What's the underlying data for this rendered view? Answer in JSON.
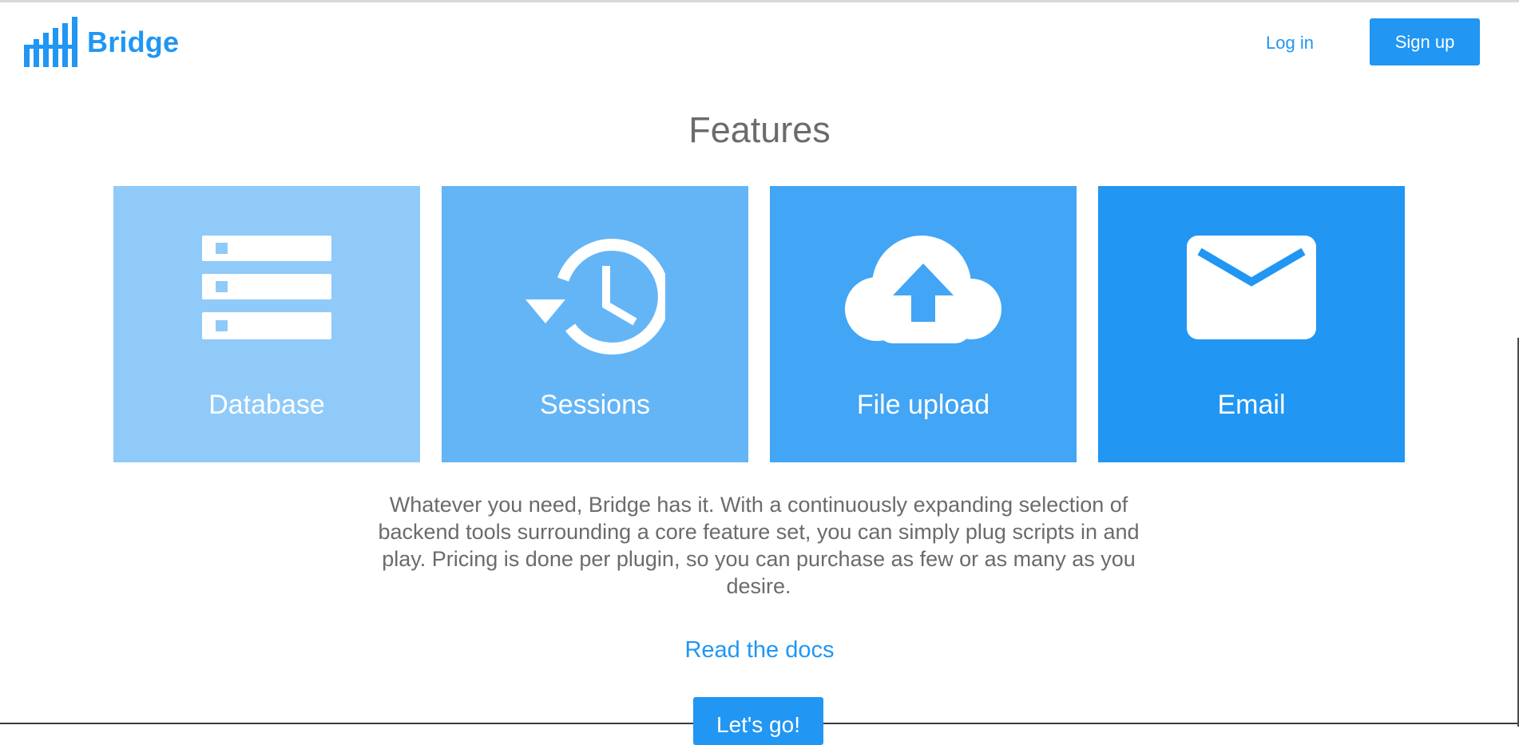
{
  "header": {
    "brand": "Bridge",
    "login_label": "Log in",
    "signup_label": "Sign up"
  },
  "main": {
    "title": "Features",
    "cards": [
      {
        "label": "Database",
        "icon": "database-icon",
        "color": "#90caf9"
      },
      {
        "label": "Sessions",
        "icon": "history-icon",
        "color": "#64b5f6"
      },
      {
        "label": "File upload",
        "icon": "cloud-upload-icon",
        "color": "#42a5f5"
      },
      {
        "label": "Email",
        "icon": "email-icon",
        "color": "#2196f3"
      }
    ],
    "description": "Whatever you need, Bridge has it. With a continuously expanding selection of backend tools surrounding a core feature set, you can simply plug scripts in and play. Pricing is done per plugin, so you can purchase as few or as many as you desire.",
    "docs_link": "Read the docs",
    "cta_label": "Let's go!"
  },
  "colors": {
    "accent": "#2196f3",
    "text": "#6b6b6b"
  }
}
